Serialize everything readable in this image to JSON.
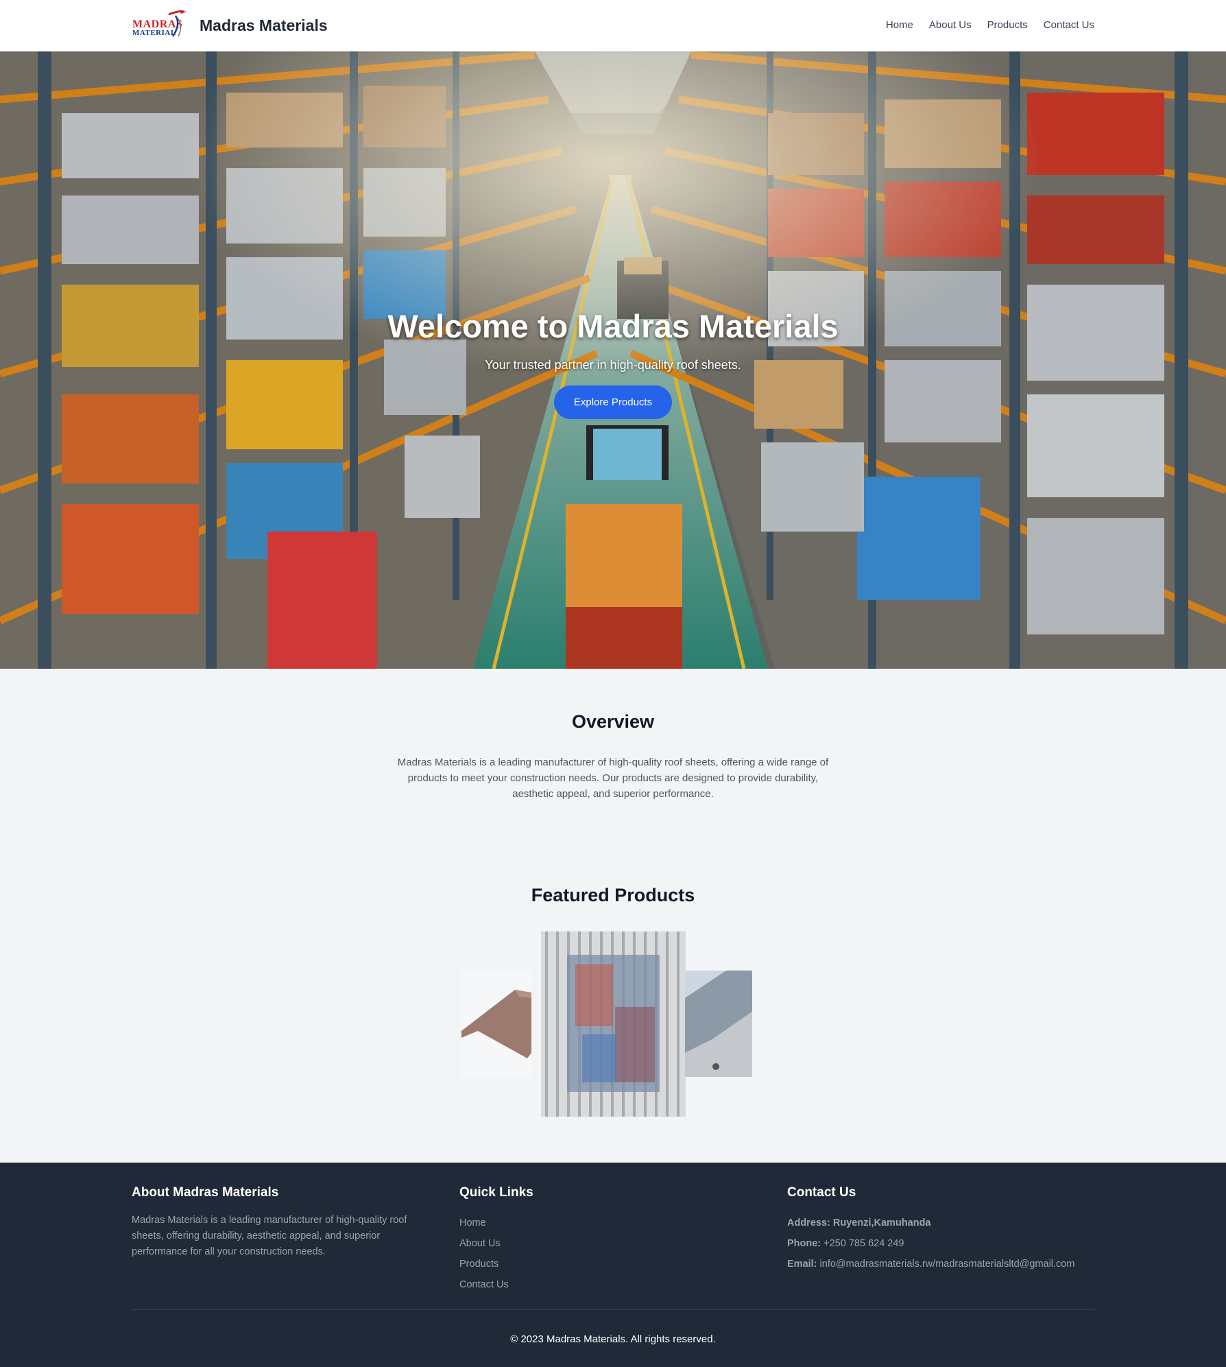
{
  "nav": {
    "logo_line1": "MADRAS",
    "logo_line2": "MATERIAL",
    "title": "Madras Materials",
    "links": [
      "Home",
      "About Us",
      "Products",
      "Contact Us"
    ]
  },
  "hero": {
    "title": "Welcome to Madras Materials",
    "subtitle": "Your trusted partner in high-quality roof sheets.",
    "button": "Explore Products"
  },
  "overview": {
    "title": "Overview",
    "text": "Madras Materials is a leading manufacturer of high-quality roof sheets, offering a wide range of products to meet your construction needs. Our products are designed to provide durability, aesthetic appeal, and superior performance."
  },
  "featured": {
    "title": "Featured Products"
  },
  "footer": {
    "about_title": "About Madras Materials",
    "about_text": "Madras Materials is a leading manufacturer of high-quality roof sheets, offering durability, aesthetic appeal, and superior performance for all your construction needs.",
    "links_title": "Quick Links",
    "links": [
      "Home",
      "About Us",
      "Products",
      "Contact Us"
    ],
    "contact_title": "Contact Us",
    "address_label": "Address:",
    "address_value": "Ruyenzi,Kamuhanda",
    "phone_label": "Phone:",
    "phone_value": "+250 785 624 249",
    "email_label": "Email:",
    "email_value": "info@madrasmaterials.rw/madrasmaterialsltd@gmail.com",
    "copyright": "© 2023 Madras Materials. All rights reserved."
  },
  "colors": {
    "accent": "#2563eb",
    "footer_bg": "#1f2937",
    "logo_red": "#d0232a",
    "logo_blue": "#1e3a8a"
  }
}
